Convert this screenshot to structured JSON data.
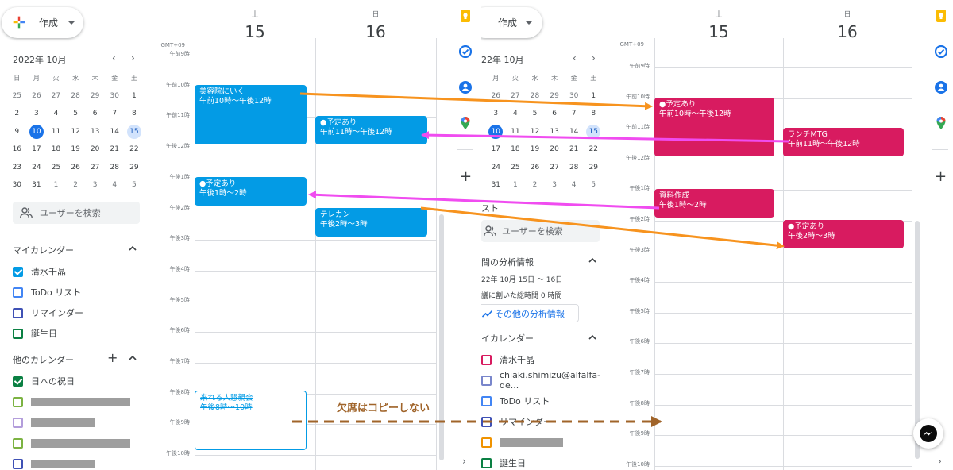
{
  "left": {
    "create_label": "作成",
    "mini_cal": {
      "title": "2022年 10月",
      "weekdays": [
        "日",
        "月",
        "火",
        "水",
        "木",
        "金",
        "土"
      ],
      "weeks": [
        [
          "25",
          "26",
          "27",
          "28",
          "29",
          "30",
          "1"
        ],
        [
          "2",
          "3",
          "4",
          "5",
          "6",
          "7",
          "8"
        ],
        [
          "9",
          "10",
          "11",
          "12",
          "13",
          "14",
          "15"
        ],
        [
          "16",
          "17",
          "18",
          "19",
          "20",
          "21",
          "22"
        ],
        [
          "23",
          "24",
          "25",
          "26",
          "27",
          "28",
          "29"
        ],
        [
          "30",
          "31",
          "1",
          "2",
          "3",
          "4",
          "5"
        ]
      ],
      "today": "10",
      "selected": "15"
    },
    "search_users": "ユーザーを検索",
    "my_calendars": {
      "title": "マイカレンダー",
      "items": [
        {
          "label": "清水千晶",
          "color": "#039be5",
          "checked": true
        },
        {
          "label": "ToDo リスト",
          "color": "#4285f4",
          "checked": false
        },
        {
          "label": "リマインダー",
          "color": "#3f51b5",
          "checked": false
        },
        {
          "label": "誕生日",
          "color": "#0b8043",
          "checked": false
        }
      ]
    },
    "other_calendars": {
      "title": "他のカレンダー",
      "items": [
        {
          "label": "日本の祝日",
          "color": "#0b8043",
          "checked": true
        },
        {
          "label": "",
          "color": "#7cb342",
          "checked": false,
          "redacted": true
        },
        {
          "label": "",
          "color": "#b39ddb",
          "checked": false,
          "redacted": true
        },
        {
          "label": "",
          "color": "#7cb342",
          "checked": false,
          "redacted": true
        },
        {
          "label": "",
          "color": "#3f51b5",
          "checked": false,
          "redacted": true
        }
      ]
    },
    "days": [
      {
        "name": "土",
        "num": "15"
      },
      {
        "name": "日",
        "num": "16"
      }
    ],
    "timezone": "GMT+09",
    "times": [
      "午前9時",
      "午前10時",
      "午前11時",
      "午後12時",
      "午後1時",
      "午後2時",
      "午後3時",
      "午後4時",
      "午後5時",
      "午後6時",
      "午後7時",
      "午後8時",
      "午後9時",
      "午後10時"
    ],
    "events": [
      {
        "title": "美容院にいく",
        "time": "午前10時～午後12時",
        "style": "blue"
      },
      {
        "title": "●予定あり",
        "time": "午前11時～午後12時",
        "style": "blue"
      },
      {
        "title": "●予定あり",
        "time": "午後1時～2時",
        "style": "blue"
      },
      {
        "title": "テレカン",
        "time": "午後2時～3時",
        "style": "blue"
      },
      {
        "title": "来れる人懇親会",
        "time": "午後8時～10時",
        "style": "outline"
      }
    ]
  },
  "right": {
    "create_label": "作成",
    "mini_cal": {
      "title": "22年 10月",
      "weekdays": [
        "月",
        "火",
        "水",
        "木",
        "金",
        "土"
      ],
      "weeks": [
        [
          "26",
          "27",
          "28",
          "29",
          "30",
          "1"
        ],
        [
          "3",
          "4",
          "5",
          "6",
          "7",
          "8"
        ],
        [
          "10",
          "11",
          "12",
          "13",
          "14",
          "15"
        ],
        [
          "17",
          "18",
          "19",
          "20",
          "21",
          "22"
        ],
        [
          "24",
          "25",
          "26",
          "27",
          "28",
          "29"
        ],
        [
          "31",
          "1",
          "2",
          "3",
          "4",
          "5"
        ]
      ]
    },
    "partial_list": "スト",
    "search_users": "ユーザーを検索",
    "insights": {
      "title": "間の分析情報",
      "range": "22年 10月 15日 ～ 16日",
      "meeting_time": "議に割いた総時間 0 時間",
      "more_button": "その他の分析情報"
    },
    "my_calendars": {
      "title": "イカレンダー",
      "items": [
        {
          "label": "清水千晶",
          "color": "#d81b60"
        },
        {
          "label": "chiaki.shimizu@alfalfa-de...",
          "color": "#7986cb"
        },
        {
          "label": "ToDo リスト",
          "color": "#4285f4"
        },
        {
          "label": "リマインダー",
          "color": "#3f51b5"
        },
        {
          "label": "",
          "color": "#f09300",
          "redacted": true
        },
        {
          "label": "誕生日",
          "color": "#0b8043"
        }
      ]
    },
    "days": [
      {
        "name": "土",
        "num": "15"
      },
      {
        "name": "日",
        "num": "16"
      }
    ],
    "timezone": "GMT+09",
    "times": [
      "午前9時",
      "午前10時",
      "午前11時",
      "午後12時",
      "午後1時",
      "午後2時",
      "午後3時",
      "午後4時",
      "午後5時",
      "午後6時",
      "午後7時",
      "午後8時",
      "午後9時",
      "午後10時"
    ],
    "events": [
      {
        "title": "●予定あり",
        "time": "午前10時～午後12時",
        "style": "mag"
      },
      {
        "title": "ランチMTG",
        "time": "午前11時～午後12時",
        "style": "mag"
      },
      {
        "title": "資料作成",
        "time": "午後1時～2時",
        "style": "mag"
      },
      {
        "title": "●予定あり",
        "time": "午後2時～3時",
        "style": "mag"
      }
    ]
  },
  "annotation": "欠席はコピーしない",
  "colors": {
    "arrow_orange": "#f7931e",
    "arrow_magenta": "#f04cf0",
    "arrow_dashed": "#a0642a",
    "event_blue": "#039be5",
    "event_magenta": "#d81b60",
    "today_blue": "#1a73e8"
  },
  "icons": [
    "keep-icon",
    "tasks-icon",
    "contacts-icon",
    "maps-icon",
    "add-icon",
    "chevron-right-icon",
    "messenger-icon"
  ]
}
